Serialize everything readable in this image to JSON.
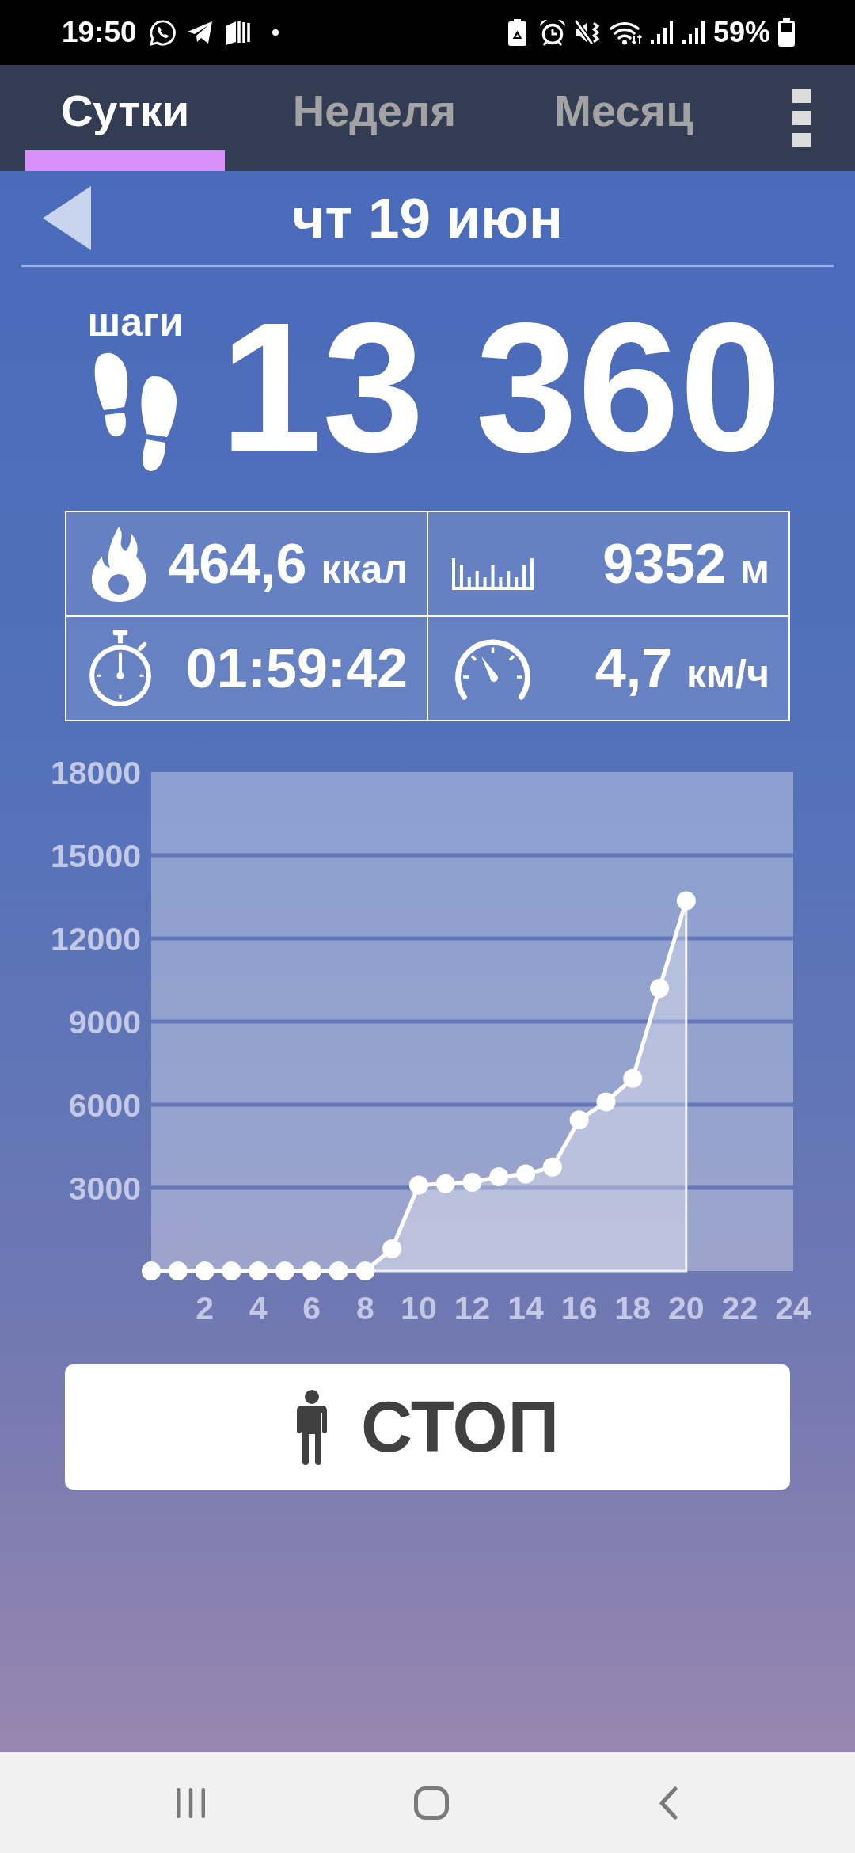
{
  "status_bar": {
    "time": "19:50",
    "battery": "59%"
  },
  "tabs": [
    {
      "label": "Сутки",
      "selected": true
    },
    {
      "label": "Неделя",
      "selected": false
    },
    {
      "label": "Месяц",
      "selected": false
    }
  ],
  "date": "чт 19 июн",
  "steps": {
    "label": "шаги",
    "value": "13 360"
  },
  "stats": [
    {
      "kind": "calories",
      "value": "464,6",
      "unit": "ккал"
    },
    {
      "kind": "distance",
      "value": "9352",
      "unit": "м"
    },
    {
      "kind": "duration",
      "value": "01:59:42"
    },
    {
      "kind": "speed",
      "value": "4,7",
      "unit": "км/ч"
    }
  ],
  "chart": {
    "chart_data": {
      "type": "area",
      "x": [
        0,
        1,
        2,
        3,
        4,
        5,
        6,
        7,
        8,
        9,
        10,
        11,
        12,
        13,
        14,
        15,
        16,
        17,
        18,
        19,
        20
      ],
      "values": [
        0,
        0,
        0,
        0,
        0,
        0,
        0,
        0,
        0,
        800,
        3100,
        3150,
        3200,
        3400,
        3500,
        3750,
        5450,
        6100,
        6950,
        10200,
        13360
      ],
      "xlim": [
        0,
        24
      ],
      "ylim": [
        0,
        18000
      ],
      "xticks": [
        2,
        4,
        6,
        8,
        10,
        12,
        14,
        16,
        18,
        20,
        22,
        24
      ],
      "yticks": [
        3000,
        6000,
        9000,
        12000,
        15000,
        18000
      ],
      "grid": true
    }
  },
  "stop_button": {
    "label": "СТОП"
  }
}
